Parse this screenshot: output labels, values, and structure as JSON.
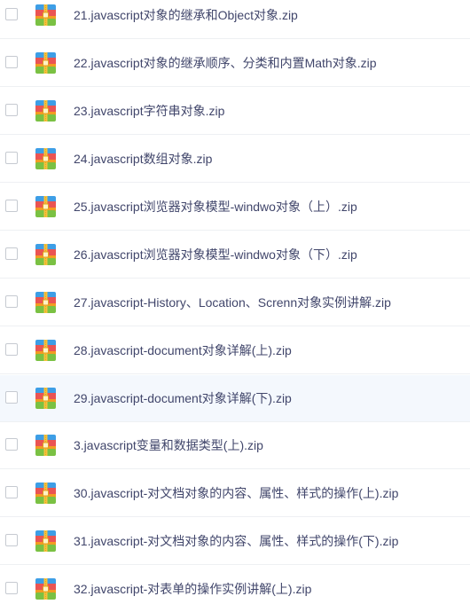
{
  "file_list": {
    "icon_name": "zip-archive-icon",
    "colors": {
      "text": "#41466b",
      "row_highlight": "#f4f8fd",
      "divider": "#eef0f3",
      "icon_blue": "#3d9ee6",
      "icon_red": "#ea5453",
      "icon_green": "#7ac143",
      "icon_orange": "#f39b22",
      "icon_zipper": "#f7c23c"
    },
    "items": [
      {
        "name": "21.javascript对象的继承和Object对象.zip",
        "checked": false,
        "highlighted": false
      },
      {
        "name": "22.javascript对象的继承顺序、分类和内置Math对象.zip",
        "checked": false,
        "highlighted": false
      },
      {
        "name": "23.javascript字符串对象.zip",
        "checked": false,
        "highlighted": false
      },
      {
        "name": "24.javascript数组对象.zip",
        "checked": false,
        "highlighted": false
      },
      {
        "name": "25.javascript浏览器对象模型-windwo对象（上）.zip",
        "checked": false,
        "highlighted": false
      },
      {
        "name": "26.javascript浏览器对象模型-windwo对象（下）.zip",
        "checked": false,
        "highlighted": false
      },
      {
        "name": "27.javascript-History、Location、Screnn对象实例讲解.zip",
        "checked": false,
        "highlighted": false
      },
      {
        "name": "28.javascript-document对象详解(上).zip",
        "checked": false,
        "highlighted": false
      },
      {
        "name": "29.javascript-document对象详解(下).zip",
        "checked": false,
        "highlighted": true
      },
      {
        "name": "3.javascript变量和数据类型(上).zip",
        "checked": false,
        "highlighted": false
      },
      {
        "name": "30.javascript-对文档对象的内容、属性、样式的操作(上).zip",
        "checked": false,
        "highlighted": false
      },
      {
        "name": "31.javascript-对文档对象的内容、属性、样式的操作(下).zip",
        "checked": false,
        "highlighted": false
      },
      {
        "name": "32.javascript-对表单的操作实例讲解(上).zip",
        "checked": false,
        "highlighted": false
      }
    ]
  }
}
